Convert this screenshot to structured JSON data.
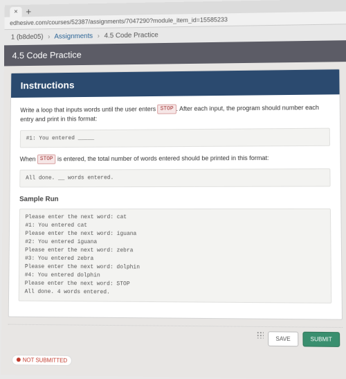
{
  "browser": {
    "url": "edhesive.com/courses/52387/assignments/7047290?module_item_id=15585233",
    "tab_close": "×",
    "tab_plus": "+"
  },
  "breadcrumbs": {
    "course": "1 (b8de05)",
    "section": "Assignments",
    "page": "4.5 Code Practice"
  },
  "title": "4.5 Code Practice",
  "panel": {
    "header": "Instructions",
    "intro_a": "Write a loop that inputs words until the user enters ",
    "intro_stop": "STOP",
    "intro_b": ". After each input, the program should number each entry and print in this format:",
    "block1": "#1: You entered _____",
    "when_a": "When ",
    "when_stop": "STOP",
    "when_b": " is entered, the total number of words entered should be printed in this format:",
    "block2": "All done. __ words entered.",
    "sample_head": "Sample Run",
    "sample_run": "Please enter the next word: cat\n#1: You entered cat\nPlease enter the next word: iguana\n#2: You entered iguana\nPlease enter the next word: zebra\n#3: You entered zebra\nPlease enter the next word: dolphin\n#4: You entered dolphin\nPlease enter the next word: STOP\nAll done. 4 words entered."
  },
  "buttons": {
    "save": "SAVE",
    "submit": "SUBMIT"
  },
  "status": {
    "label": "NOT SUBMITTED"
  }
}
